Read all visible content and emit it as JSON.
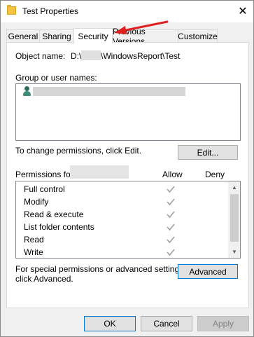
{
  "window": {
    "title": "Test Properties",
    "close_glyph": "✕"
  },
  "tabs": [
    {
      "label": "General"
    },
    {
      "label": "Sharing"
    },
    {
      "label": "Security",
      "active": true
    },
    {
      "label": "Previous Versions"
    },
    {
      "label": "Customize"
    }
  ],
  "security": {
    "object_name_label": "Object name:",
    "object_name_prefix": "D:\\",
    "object_name_suffix": "\\WindowsReport\\Test",
    "group_label": "Group or user names:",
    "change_text": "To change permissions, click Edit.",
    "edit_button": "Edit...",
    "permissions_for_label": "Permissions for",
    "allow_header": "Allow",
    "deny_header": "Deny",
    "permissions": [
      {
        "name": "Full control",
        "allow": true,
        "deny": false
      },
      {
        "name": "Modify",
        "allow": true,
        "deny": false
      },
      {
        "name": "Read & execute",
        "allow": true,
        "deny": false
      },
      {
        "name": "List folder contents",
        "allow": true,
        "deny": false
      },
      {
        "name": "Read",
        "allow": true,
        "deny": false
      },
      {
        "name": "Write",
        "allow": true,
        "deny": false
      }
    ],
    "special_text_line1": "For special permissions or advanced settings,",
    "special_text_line2": "click Advanced.",
    "advanced_button": "Advanced"
  },
  "footer": {
    "ok": "OK",
    "cancel": "Cancel",
    "apply": "Apply"
  },
  "colors": {
    "accent_arrow": "#e02020",
    "check_gray": "#a0a0a0"
  }
}
